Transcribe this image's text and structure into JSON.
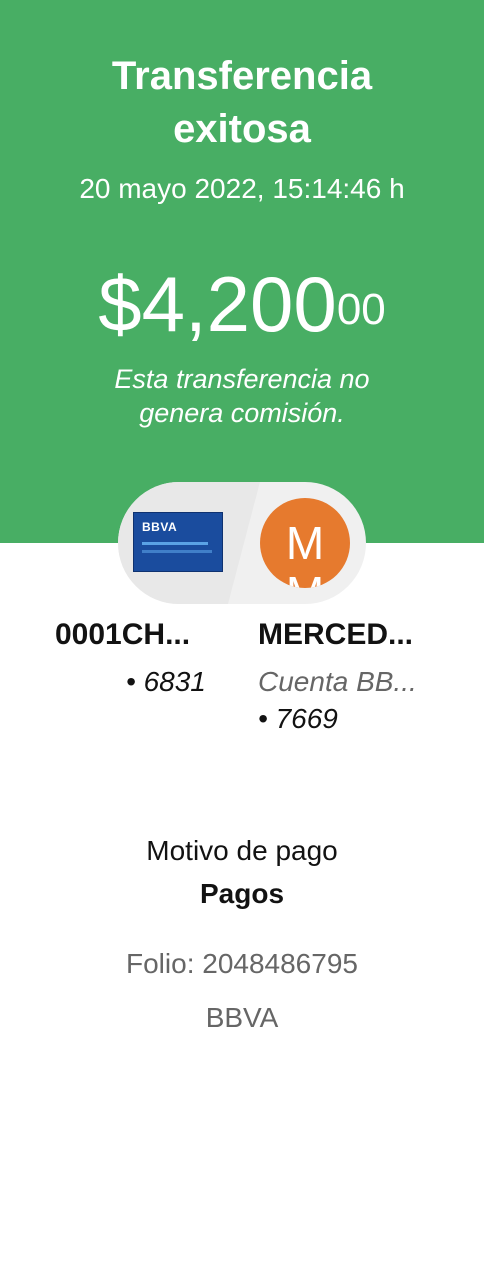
{
  "header": {
    "title_line1": "Transferencia",
    "title_line2": "exitosa",
    "datetime": "20 mayo 2022, 15:14:46 h",
    "amount_main": "$4,200",
    "amount_cents": "00",
    "note_line1": "Esta transferencia no",
    "note_line2": "genera comisión."
  },
  "origin": {
    "bank_logo": "BBVA",
    "icon": "bank-card-icon",
    "name": "0001CH...",
    "account_suffix": "• 6831"
  },
  "destination": {
    "avatar_letter_1": "M",
    "avatar_letter_2": "M",
    "name": "MERCED...",
    "account_type": "Cuenta BB...",
    "account_suffix": "• 7669"
  },
  "details": {
    "reason_label": "Motivo de pago",
    "reason_value": "Pagos",
    "folio": "Folio: 2048486795",
    "bank": "BBVA"
  },
  "colors": {
    "hero_bg": "#48ae64",
    "avatar_bg": "#e67a2e",
    "card_bg": "#1a4c9e"
  }
}
